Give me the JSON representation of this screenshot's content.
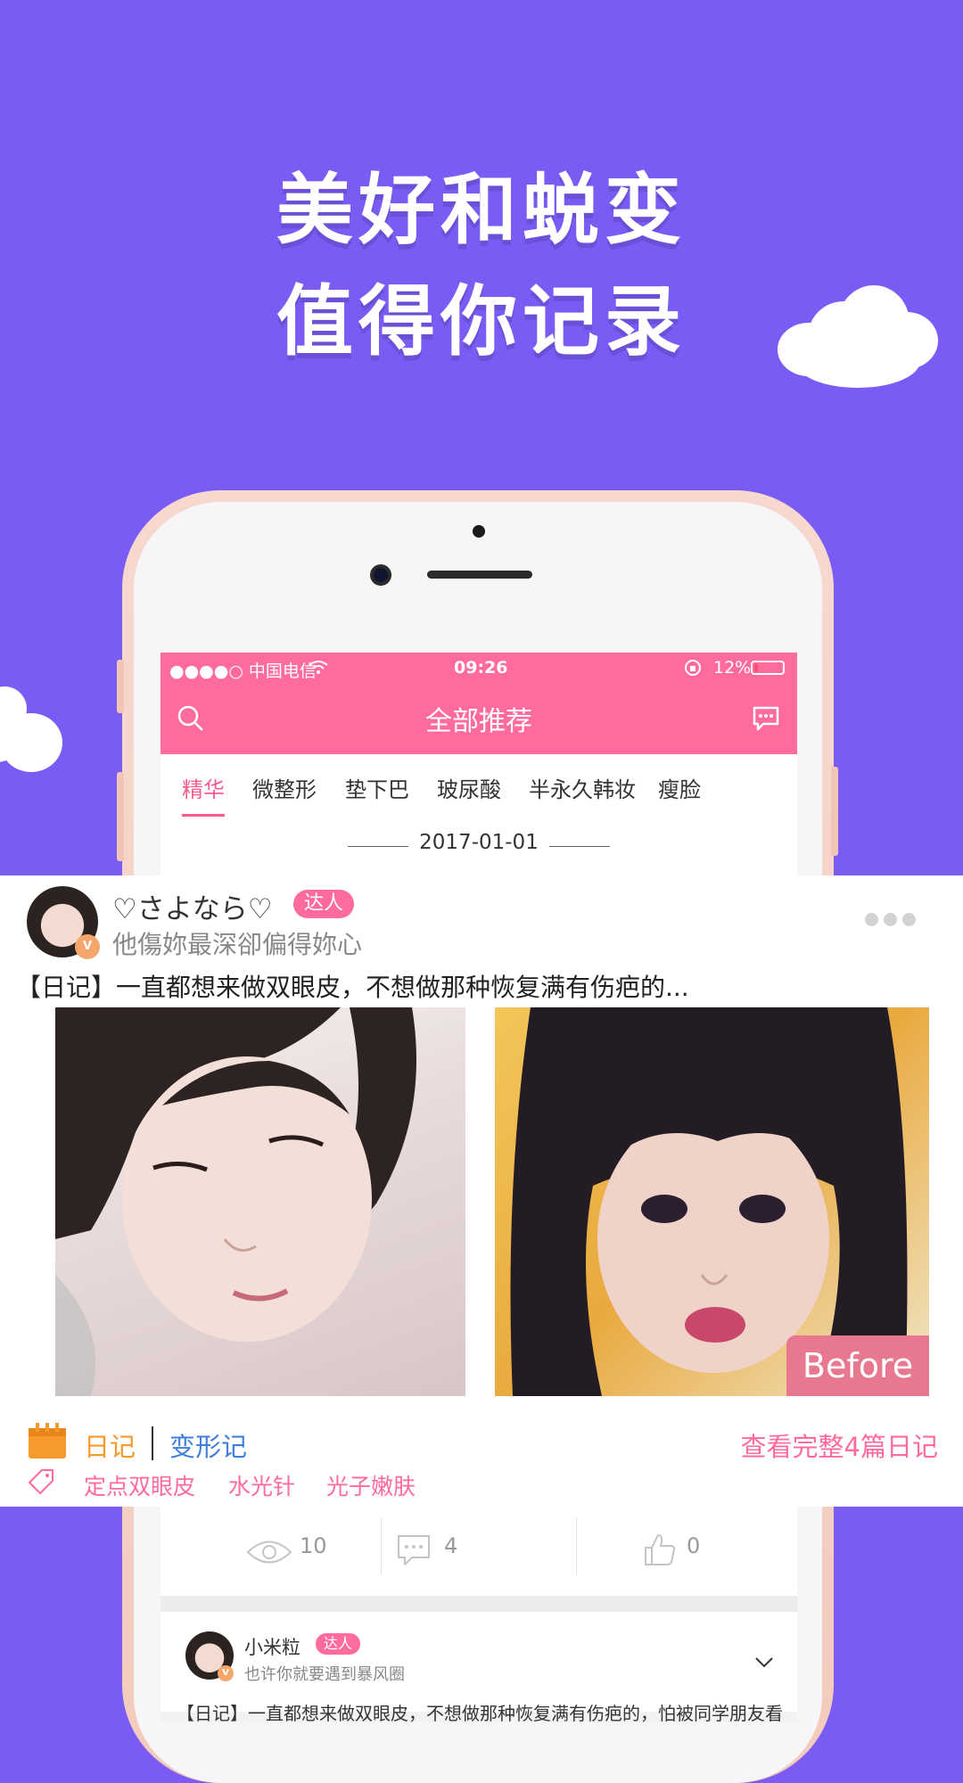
{
  "promo": {
    "line1": "美好和蜕变",
    "line2": "值得你记录"
  },
  "colors": {
    "background": "#7a5cf5",
    "accent_pink": "#ff6b9a",
    "diary_orange": "#f79a2b",
    "link_blue": "#3f7fe0"
  },
  "statusbar": {
    "carrier": "●●●●○ 中国电信",
    "time": "09:26",
    "battery": "12%"
  },
  "navbar": {
    "title": "全部推荐",
    "left_icon": "search-icon",
    "right_icon": "message-icon"
  },
  "tabs": [
    "精华",
    "微整形",
    "垫下巴",
    "玻尿酸",
    "半永久韩妆",
    "瘦脸"
  ],
  "active_tab": "精华",
  "date": "2017-01-01",
  "post": {
    "username": "♡さよなら♡",
    "badge": "达人",
    "bio": "他傷妳最深卻偏得妳心",
    "title": "【日记】一直都想来做双眼皮，不想做那种恢复满有伤疤的...",
    "before_label": "Before",
    "diary_label": "日记",
    "transform_label": "变形记",
    "view_full": "查看完整4篇日记",
    "tags": [
      "定点双眼皮",
      "水光针",
      "光子嫩肤"
    ],
    "stats": {
      "views": "10",
      "comments": "4",
      "likes": "0"
    }
  },
  "post2": {
    "username": "小米粒",
    "badge": "达人",
    "bio": "也许你就要遇到暴风圈",
    "title_partial": "【日记】一直都想来做双眼皮，不想做那种恢复满有伤疤的，怕被同学朋友看"
  }
}
